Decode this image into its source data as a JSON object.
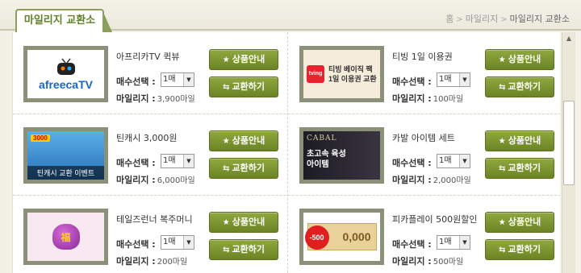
{
  "header": {
    "title": "마일리지 교환소",
    "breadcrumb": [
      "홈",
      "마일리지",
      "마일리지 교환소"
    ],
    "breadcrumb_sep": ">"
  },
  "labels": {
    "qty": "매수선택 :",
    "mileage": "마일리지 :",
    "info_button": "상품안내",
    "exchange_button": "교환하기",
    "scroll_up": "▲"
  },
  "colors": {
    "accent": "#6b8424",
    "tab_border": "#8aa05a",
    "title_text": "#5e8125"
  },
  "items": [
    {
      "name": "아프리카TV 퀵뷰",
      "qty": "1매",
      "mileage": "3,900마일",
      "thumb_text": "afreecaTV",
      "thumb_icon": "tv-icon"
    },
    {
      "name": "티빙 1일 이용권",
      "qty": "1매",
      "mileage": "100마일",
      "thumb_text": "티빙 베이직 팩\n1일 이용권 교환",
      "thumb_badge": "tving"
    },
    {
      "name": "틴캐시 3,000원",
      "qty": "1매",
      "mileage": "6,000마일",
      "thumb_text": "틴캐시 교환 이벤트",
      "thumb_badge": "3000"
    },
    {
      "name": "카발 아이템 세트",
      "qty": "1매",
      "mileage": "2,000마일",
      "thumb_text": "초고속 육성\n아이템",
      "thumb_badge": "CABAL"
    },
    {
      "name": "테일즈런너 복주머니",
      "qty": "1매",
      "mileage": "200마일",
      "thumb_text": "福",
      "thumb_icon": "lucky-pouch-icon"
    },
    {
      "name": "피카플레이 500원할인",
      "qty": "1매",
      "mileage": "500마일",
      "thumb_text": "0,000",
      "thumb_badge": "-500"
    }
  ]
}
